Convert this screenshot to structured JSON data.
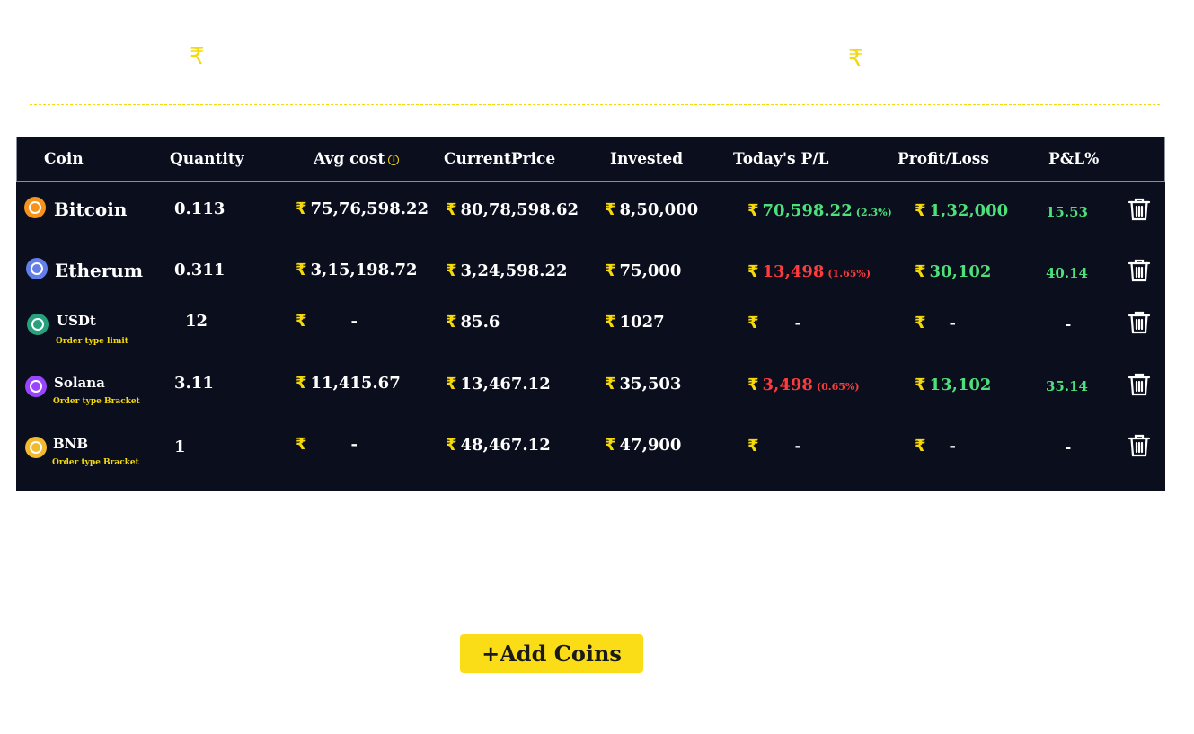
{
  "summary": {
    "currency_left": "₹",
    "currency_right": "₹"
  },
  "currency_symbol": "₹",
  "headers": {
    "coin": "Coin",
    "quantity": "Quantity",
    "avg_cost": "Avg cost",
    "current_price": "CurrentPrice",
    "invested": "Invested",
    "todays_pl": "Today's P/L",
    "profit_loss": "Profit/Loss",
    "pl_percent": "P&L%"
  },
  "rows": [
    {
      "name": "Bitcoin",
      "order_type": "",
      "quantity": "0.113",
      "avg_cost": "75,76,598.22",
      "current_price": "80,78,598.62",
      "invested": "8,50,000",
      "todays_pl": "70,598.22",
      "todays_pl_pct": "(2.3%)",
      "todays_pl_status": "profit",
      "profit_loss": "1,32,000",
      "pl_percent": "15.53",
      "logo_color": "#f7931a",
      "icon": "bitcoin-icon"
    },
    {
      "name": "Etherum",
      "order_type": "",
      "quantity": "0.311",
      "avg_cost": "3,15,198.72",
      "current_price": "3,24,598.22",
      "invested": "75,000",
      "todays_pl": "13,498",
      "todays_pl_pct": "(1.65%)",
      "todays_pl_status": "loss",
      "profit_loss": "30,102",
      "pl_percent": "40.14",
      "logo_color": "#627eea",
      "icon": "ethereum-icon"
    },
    {
      "name": "USDt",
      "order_type": "Order type limit",
      "quantity": "12",
      "avg_cost": "-",
      "current_price": "85.6",
      "invested": "1027",
      "todays_pl": "-",
      "todays_pl_pct": "",
      "profit_loss": "-",
      "pl_percent": "-",
      "logo_color": "#26a17b",
      "icon": "tether-icon"
    },
    {
      "name": "Solana",
      "order_type": "Order type Bracket",
      "quantity": "3.11",
      "avg_cost": "11,415.67",
      "current_price": "13,467.12",
      "invested": "35,503",
      "todays_pl": "3,498",
      "todays_pl_pct": "(0.65%)",
      "todays_pl_status": "loss",
      "profit_loss": "13,102",
      "pl_percent": "35.14",
      "logo_color": "#9945ff",
      "icon": "solana-icon"
    },
    {
      "name": "BNB",
      "order_type": "Order type Bracket",
      "quantity": "1",
      "avg_cost": "-",
      "current_price": "48,467.12",
      "invested": "47,900",
      "todays_pl": "-",
      "todays_pl_pct": "",
      "profit_loss": "-",
      "pl_percent": "-",
      "logo_color": "#f3ba2f",
      "icon": "bnb-icon"
    }
  ],
  "add_button": {
    "label": "+Add Coins"
  },
  "colors": {
    "accent": "#f5d90a",
    "table_bg": "#0a0e1d",
    "profit": "#4ee07a",
    "loss": "#ff3b3b",
    "button": "#fadd17"
  }
}
